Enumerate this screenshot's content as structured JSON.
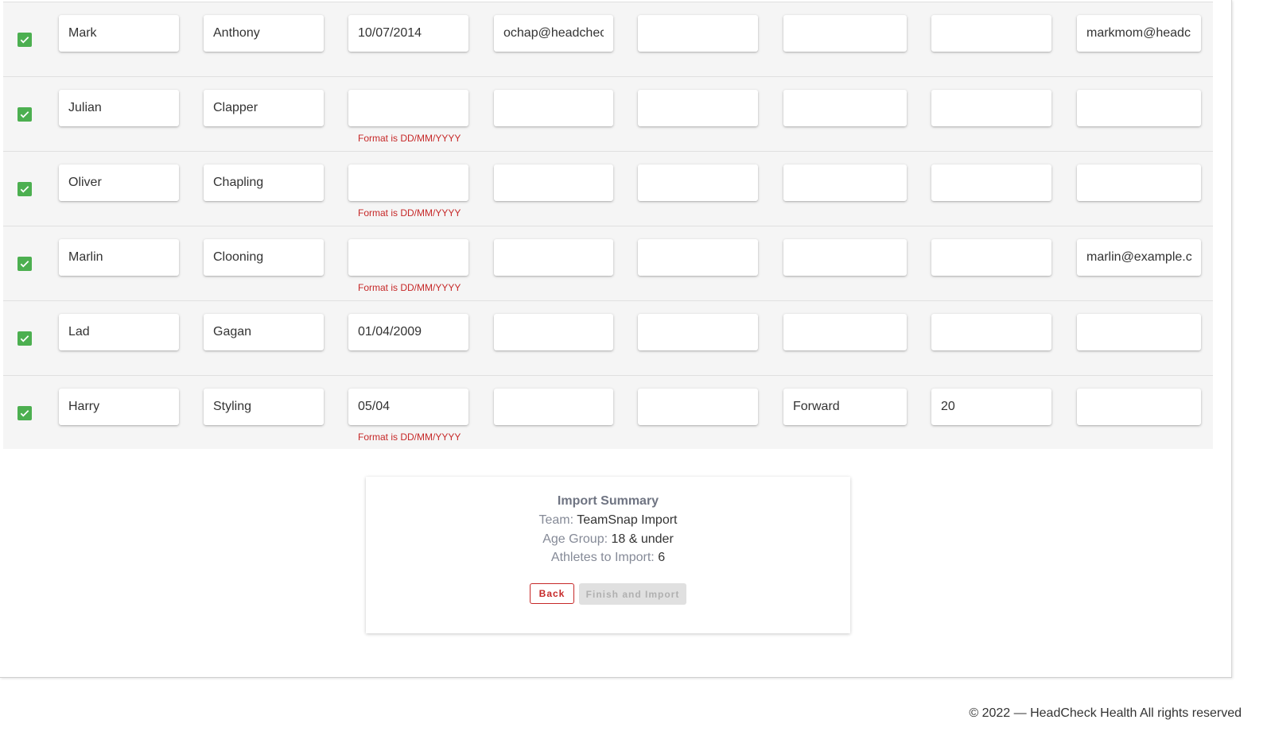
{
  "athletes": [
    {
      "selected": true,
      "first_name": "Mark",
      "last_name": "Anthony",
      "dob": "10/07/2014",
      "col4": "ochap@headcheck",
      "col5": "",
      "col6": "",
      "col7": "",
      "col8": "markmom@headch",
      "dob_error": ""
    },
    {
      "selected": true,
      "first_name": "Julian",
      "last_name": "Clapper",
      "dob": "",
      "col4": "",
      "col5": "",
      "col6": "",
      "col7": "",
      "col8": "",
      "dob_error": "Format is DD/MM/YYYY"
    },
    {
      "selected": true,
      "first_name": "Oliver",
      "last_name": "Chapling",
      "dob": "",
      "col4": "",
      "col5": "",
      "col6": "",
      "col7": "",
      "col8": "",
      "dob_error": "Format is DD/MM/YYYY"
    },
    {
      "selected": true,
      "first_name": "Marlin",
      "last_name": "Clooning",
      "dob": "",
      "col4": "",
      "col5": "",
      "col6": "",
      "col7": "",
      "col8": "marlin@example.co",
      "dob_error": "Format is DD/MM/YYYY"
    },
    {
      "selected": true,
      "first_name": "Lad",
      "last_name": "Gagan",
      "dob": "01/04/2009",
      "col4": "",
      "col5": "",
      "col6": "",
      "col7": "",
      "col8": "",
      "dob_error": ""
    },
    {
      "selected": true,
      "first_name": "Harry",
      "last_name": "Styling",
      "dob": "05/04",
      "col4": "",
      "col5": "",
      "col6": "Forward",
      "col7": "20",
      "col8": "",
      "dob_error": "Format is DD/MM/YYYY"
    }
  ],
  "summary": {
    "title": "Import Summary",
    "team_label": "Team:",
    "team_value": "TeamSnap Import",
    "age_group_label": "Age Group:",
    "age_group_value": "18 & under",
    "athletes_label": "Athletes to Import:",
    "athletes_value": "6",
    "back_label": "Back",
    "finish_label": "Finish and Import"
  },
  "footer": {
    "copyright": "© 2022 — HeadCheck Health All rights reserved"
  },
  "colors": {
    "checkbox": "#4caf50",
    "error": "#c62828",
    "row_bg": "#f5f5f5"
  }
}
